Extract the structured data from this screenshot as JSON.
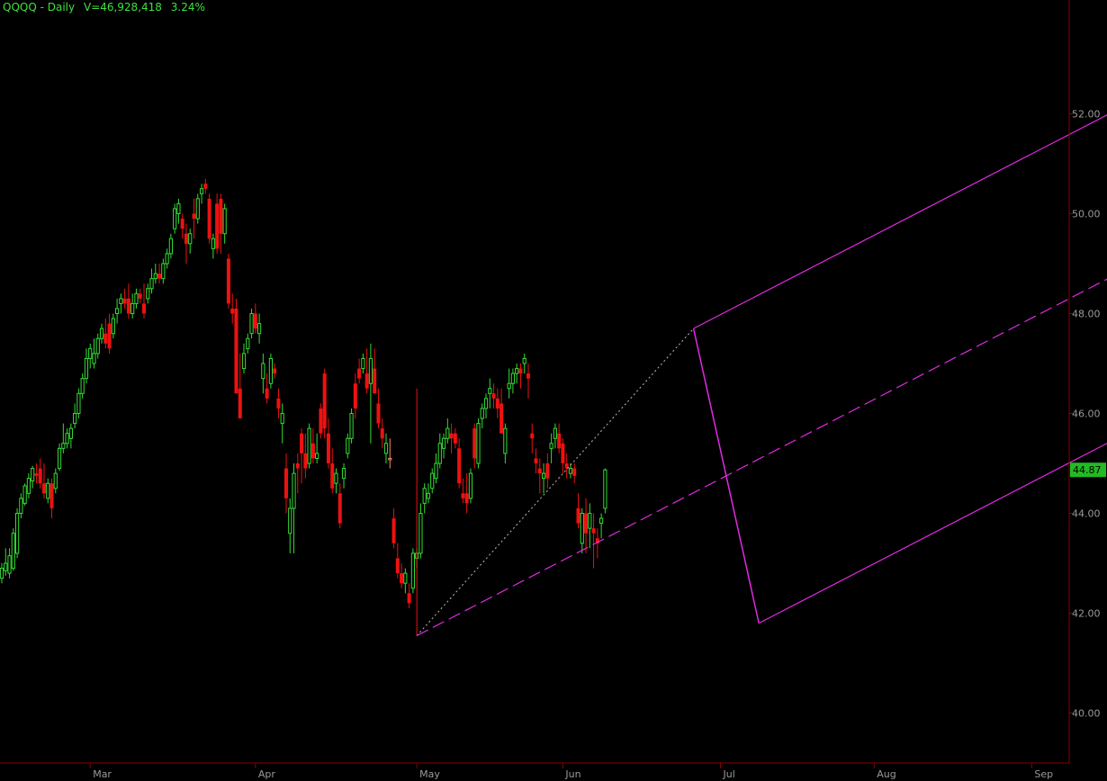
{
  "header": {
    "symbol": "QQQQ - Daily",
    "volume": "V=46,928,418",
    "change": "3.24%"
  },
  "colors": {
    "up": "#33dd33",
    "down": "#ee1111",
    "neutral": "#f08a6a",
    "pitchfork": "#e02ae0",
    "axis": "#8a0000",
    "label": "#9a9a9a",
    "header": "#3ee03e",
    "price_box": "#22bb22"
  },
  "chart_data": {
    "type": "candlestick",
    "yaxis": {
      "min": 39.0,
      "max": 53.5,
      "ticks": [
        "40.00",
        "42.00",
        "44.00",
        "46.00",
        "48.00",
        "50.00",
        "52.00"
      ]
    },
    "xaxis": {
      "labels": [
        {
          "label": "Mar",
          "index": 23
        },
        {
          "label": "Apr",
          "index": 66
        },
        {
          "label": "May",
          "index": 108
        },
        {
          "label": "Jun",
          "index": 146
        },
        {
          "label": "Jul",
          "index": 187
        },
        {
          "label": "Aug",
          "index": 227
        },
        {
          "label": "Sep",
          "index": 268
        }
      ]
    },
    "last_price": "44.87",
    "candles": [
      [
        42.7,
        43.0,
        42.6,
        42.9
      ],
      [
        42.85,
        43.3,
        42.75,
        43.0
      ],
      [
        42.8,
        43.3,
        42.7,
        43.15
      ],
      [
        42.9,
        43.7,
        42.85,
        43.6
      ],
      [
        43.2,
        44.1,
        43.1,
        44.0
      ],
      [
        44.0,
        44.4,
        43.9,
        44.3
      ],
      [
        44.2,
        44.6,
        44.15,
        44.55
      ],
      [
        44.4,
        44.8,
        44.3,
        44.7
      ],
      [
        44.65,
        44.95,
        44.5,
        44.9
      ],
      [
        44.8,
        45.0,
        44.6,
        44.75
      ],
      [
        44.9,
        45.1,
        44.5,
        44.6
      ],
      [
        44.6,
        45.0,
        44.3,
        44.4
      ],
      [
        44.3,
        44.7,
        44.2,
        44.6
      ],
      [
        44.6,
        44.7,
        43.9,
        44.1
      ],
      [
        44.5,
        44.9,
        44.4,
        44.8
      ],
      [
        44.9,
        45.4,
        44.85,
        45.3
      ],
      [
        45.3,
        45.8,
        45.2,
        45.4
      ],
      [
        45.4,
        45.7,
        45.3,
        45.6
      ],
      [
        45.5,
        45.8,
        45.3,
        45.7
      ],
      [
        45.8,
        46.2,
        45.7,
        46.0
      ],
      [
        46.0,
        46.5,
        45.9,
        46.4
      ],
      [
        46.4,
        46.8,
        46.3,
        46.7
      ],
      [
        46.7,
        47.3,
        46.6,
        47.1
      ],
      [
        47.1,
        47.4,
        46.9,
        47.3
      ],
      [
        47.0,
        47.5,
        46.9,
        47.2
      ],
      [
        47.2,
        47.6,
        47.1,
        47.5
      ],
      [
        47.5,
        47.8,
        47.4,
        47.7
      ],
      [
        47.6,
        47.9,
        47.3,
        47.4
      ],
      [
        47.8,
        48.0,
        47.2,
        47.3
      ],
      [
        47.6,
        48.0,
        47.5,
        47.9
      ],
      [
        48.0,
        48.3,
        47.8,
        48.1
      ],
      [
        48.2,
        48.4,
        48.0,
        48.3
      ],
      [
        48.3,
        48.5,
        48.1,
        48.2
      ],
      [
        48.3,
        48.6,
        47.9,
        48.0
      ],
      [
        48.0,
        48.4,
        47.9,
        48.2
      ],
      [
        48.2,
        48.5,
        48.1,
        48.4
      ],
      [
        48.4,
        48.5,
        48.2,
        48.3
      ],
      [
        48.2,
        48.6,
        47.9,
        48.0
      ],
      [
        48.3,
        48.6,
        48.2,
        48.5
      ],
      [
        48.5,
        48.9,
        48.4,
        48.7
      ],
      [
        48.7,
        49.0,
        48.6,
        48.8
      ],
      [
        48.8,
        49.0,
        48.6,
        48.7
      ],
      [
        48.7,
        49.1,
        48.6,
        49.0
      ],
      [
        49.0,
        49.3,
        48.9,
        49.2
      ],
      [
        49.2,
        49.6,
        49.1,
        49.5
      ],
      [
        49.7,
        50.2,
        49.6,
        50.1
      ],
      [
        50.0,
        50.3,
        49.8,
        50.2
      ],
      [
        49.9,
        50.0,
        49.5,
        49.7
      ],
      [
        49.6,
        49.8,
        49.0,
        49.4
      ],
      [
        49.4,
        49.7,
        49.2,
        49.6
      ],
      [
        50.0,
        50.3,
        49.5,
        49.9
      ],
      [
        49.9,
        50.4,
        49.8,
        50.3
      ],
      [
        50.4,
        50.6,
        50.2,
        50.5
      ],
      [
        50.6,
        50.7,
        50.4,
        50.5
      ],
      [
        50.3,
        50.4,
        49.4,
        49.5
      ],
      [
        49.3,
        49.6,
        49.1,
        49.5
      ],
      [
        50.2,
        50.4,
        49.2,
        49.3
      ],
      [
        50.3,
        50.4,
        49.2,
        49.6
      ],
      [
        49.6,
        50.2,
        49.4,
        50.1
      ],
      [
        49.1,
        49.2,
        48.1,
        48.2
      ],
      [
        48.1,
        48.4,
        47.8,
        48.0
      ],
      [
        48.1,
        48.3,
        46.8,
        46.4
      ],
      [
        46.5,
        47.2,
        46.4,
        45.9
      ],
      [
        46.9,
        47.4,
        46.8,
        47.2
      ],
      [
        47.3,
        47.6,
        47.2,
        47.5
      ],
      [
        47.6,
        48.1,
        47.5,
        48.0
      ],
      [
        48.0,
        48.2,
        47.6,
        47.7
      ],
      [
        47.6,
        48.0,
        47.4,
        47.8
      ],
      [
        46.7,
        47.2,
        46.4,
        47.0
      ],
      [
        46.5,
        46.8,
        46.2,
        46.3
      ],
      [
        46.6,
        47.2,
        46.5,
        47.1
      ],
      [
        46.9,
        47.0,
        46.7,
        46.8
      ],
      [
        46.3,
        46.5,
        45.9,
        46.1
      ],
      [
        45.8,
        46.2,
        45.4,
        46.0
      ],
      [
        44.9,
        45.2,
        44.0,
        44.3
      ],
      [
        43.6,
        44.3,
        43.2,
        44.1
      ],
      [
        44.1,
        45.0,
        43.2,
        44.8
      ],
      [
        45.0,
        45.2,
        44.4,
        44.9
      ],
      [
        45.6,
        45.7,
        44.6,
        45.2
      ],
      [
        45.2,
        45.6,
        44.7,
        44.9
      ],
      [
        45.0,
        45.8,
        44.9,
        45.7
      ],
      [
        45.4,
        45.7,
        45.0,
        45.1
      ],
      [
        45.1,
        45.6,
        45.0,
        45.2
      ],
      [
        46.1,
        46.2,
        45.5,
        45.6
      ],
      [
        46.8,
        46.9,
        45.5,
        45.7
      ],
      [
        45.6,
        45.9,
        44.9,
        45.0
      ],
      [
        45.0,
        45.3,
        44.4,
        44.5
      ],
      [
        44.6,
        44.9,
        44.4,
        44.8
      ],
      [
        44.4,
        44.6,
        43.7,
        43.8
      ],
      [
        44.7,
        45.0,
        44.5,
        44.9
      ],
      [
        45.2,
        45.6,
        45.1,
        45.5
      ],
      [
        45.5,
        46.1,
        45.4,
        46.0
      ],
      [
        46.6,
        46.8,
        45.9,
        46.1
      ],
      [
        46.9,
        47.1,
        46.6,
        46.7
      ],
      [
        46.9,
        47.2,
        46.8,
        47.1
      ],
      [
        46.8,
        47.3,
        46.4,
        46.5
      ],
      [
        46.6,
        47.4,
        45.4,
        47.1
      ],
      [
        46.9,
        47.3,
        46.4,
        46.4
      ],
      [
        46.2,
        46.5,
        45.7,
        45.8
      ],
      [
        45.7,
        45.9,
        45.3,
        45.5
      ],
      [
        45.2,
        45.6,
        45.0,
        45.4
      ],
      [
        45.1,
        45.5,
        44.9,
        45.1
      ],
      [
        43.9,
        44.1,
        43.3,
        43.4
      ],
      [
        43.1,
        43.4,
        42.7,
        42.8
      ],
      [
        42.8,
        43.0,
        42.5,
        42.6
      ],
      [
        42.6,
        42.9,
        42.4,
        42.8
      ],
      [
        42.4,
        42.6,
        42.1,
        42.2
      ],
      [
        42.5,
        43.3,
        42.4,
        43.2
      ],
      [
        43.1,
        43.3,
        42.9,
        43.2
      ],
      [
        43.2,
        44.2,
        43.1,
        44.0
      ],
      [
        44.2,
        44.6,
        44.0,
        44.5
      ],
      [
        44.3,
        44.6,
        44.2,
        44.4
      ],
      [
        44.5,
        44.9,
        44.4,
        44.8
      ],
      [
        44.7,
        45.2,
        44.6,
        45.0
      ],
      [
        45.0,
        45.6,
        44.9,
        45.4
      ],
      [
        45.3,
        45.6,
        45.1,
        45.5
      ],
      [
        45.5,
        45.9,
        45.4,
        45.7
      ],
      [
        45.6,
        45.8,
        45.2,
        45.5
      ],
      [
        45.6,
        45.7,
        45.3,
        45.4
      ],
      [
        45.3,
        45.5,
        44.5,
        44.6
      ],
      [
        44.4,
        44.7,
        44.2,
        44.3
      ],
      [
        44.4,
        44.8,
        44.0,
        44.2
      ],
      [
        44.3,
        44.9,
        44.2,
        44.8
      ],
      [
        45.7,
        45.8,
        44.9,
        45.1
      ],
      [
        45.0,
        45.9,
        44.9,
        45.8
      ],
      [
        45.9,
        46.2,
        45.7,
        46.1
      ],
      [
        46.1,
        46.4,
        45.9,
        46.3
      ],
      [
        46.4,
        46.7,
        46.1,
        46.5
      ],
      [
        46.4,
        46.6,
        46.1,
        46.3
      ],
      [
        46.3,
        46.5,
        45.9,
        46.1
      ],
      [
        46.2,
        46.5,
        45.8,
        45.6
      ],
      [
        45.2,
        45.8,
        45.0,
        45.7
      ],
      [
        46.5,
        46.9,
        46.3,
        46.6
      ],
      [
        46.6,
        46.9,
        46.4,
        46.8
      ],
      [
        46.8,
        47.0,
        46.6,
        46.9
      ],
      [
        46.9,
        47.0,
        46.5,
        46.8
      ],
      [
        47.0,
        47.2,
        46.8,
        47.1
      ],
      [
        46.8,
        47.0,
        46.3,
        46.7
      ],
      [
        45.6,
        45.8,
        45.2,
        45.5
      ],
      [
        45.1,
        45.3,
        44.8,
        45.0
      ],
      [
        44.9,
        45.1,
        44.4,
        44.8
      ],
      [
        44.7,
        45.0,
        44.4,
        44.8
      ],
      [
        45.0,
        45.2,
        44.5,
        44.7
      ],
      [
        45.3,
        45.6,
        45.0,
        45.4
      ],
      [
        45.5,
        45.8,
        45.3,
        45.7
      ],
      [
        45.6,
        45.8,
        45.2,
        45.3
      ],
      [
        45.4,
        45.5,
        44.8,
        45.0
      ],
      [
        45.0,
        45.2,
        44.7,
        44.9
      ],
      [
        44.8,
        45.0,
        44.7,
        44.9
      ],
      [
        44.9,
        45.0,
        44.6,
        44.75
      ],
      [
        44.1,
        44.4,
        43.7,
        43.8
      ],
      [
        43.4,
        44.1,
        43.2,
        44.0
      ],
      [
        44.0,
        44.3,
        43.2,
        43.6
      ],
      [
        43.7,
        44.2,
        43.3,
        44.0
      ],
      [
        43.7,
        44.0,
        42.9,
        43.6
      ],
      [
        43.5,
        43.7,
        43.1,
        43.4
      ],
      [
        43.8,
        44.0,
        43.5,
        43.9
      ],
      [
        44.1,
        44.9,
        44.0,
        44.87
      ]
    ],
    "pitchfork": {
      "pivot_a": {
        "index": 108,
        "price": 41.55
      },
      "pivot_b": {
        "index": 180,
        "price": 47.7
      },
      "pivot_c": {
        "index": 197,
        "price": 41.8
      },
      "extend_to_index": 288
    }
  }
}
